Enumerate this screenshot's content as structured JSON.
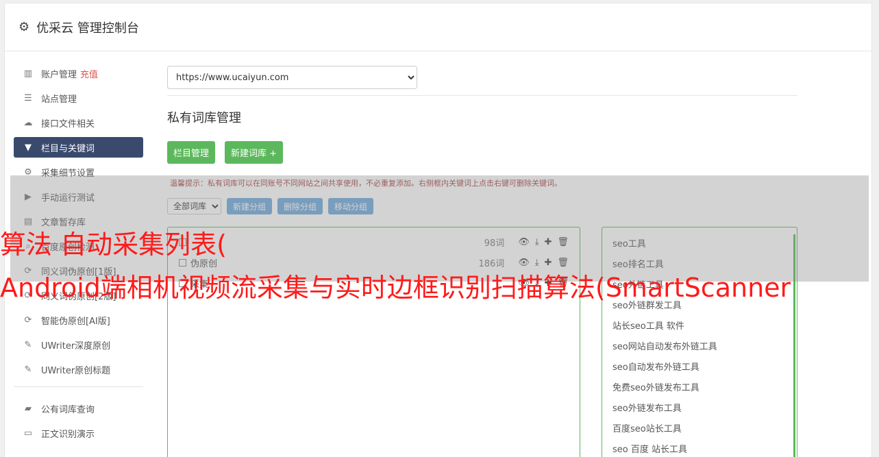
{
  "header": {
    "title": "优采云 管理控制台"
  },
  "sidebar": {
    "items": [
      {
        "label": "账户管理",
        "extra": "充值",
        "icon": "bar-chart-icon",
        "glyph": "▥"
      },
      {
        "label": "站点管理",
        "icon": "server-icon",
        "glyph": "☰"
      },
      {
        "label": "接口文件相关",
        "icon": "cloud-upload-icon",
        "glyph": "☁"
      },
      {
        "label": "栏目与关键词",
        "icon": "filter-icon",
        "glyph": "▼",
        "active": true
      },
      {
        "label": "采集细节设置",
        "icon": "gears-icon",
        "glyph": "⚙"
      },
      {
        "label": "手动运行测试",
        "icon": "play-circle-icon",
        "glyph": "▶"
      },
      {
        "label": "文章暂存库",
        "icon": "database-icon",
        "glyph": "▤"
      },
      {
        "label": "百度原创检测",
        "icon": "search-icon",
        "glyph": "⌕"
      },
      {
        "label": "同义词伪原创[1版]",
        "icon": "refresh-icon",
        "glyph": "⟳"
      },
      {
        "label": "同义词伪原创[2版]",
        "icon": "refresh-icon",
        "glyph": "⟳"
      },
      {
        "label": "智能伪原创[AI版]",
        "icon": "refresh-icon",
        "glyph": "⟳"
      },
      {
        "label": "UWriter深度原创",
        "icon": "edit-icon",
        "glyph": "✎"
      },
      {
        "label": "UWriter原创标题",
        "icon": "edit-icon",
        "glyph": "✎"
      }
    ],
    "items2": [
      {
        "label": "公有词库查询",
        "icon": "book-icon",
        "glyph": "▰"
      },
      {
        "label": "正文识别演示",
        "icon": "monitor-icon",
        "glyph": "▭"
      }
    ]
  },
  "main": {
    "site_select": "https://www.ucaiyun.com",
    "title": "私有词库管理",
    "btn_column": "栏目管理",
    "btn_new_lib": "新建词库 +",
    "tip": "温馨提示：私有词库可以在同账号不同网站之间共享使用，不必重复添加。右侧框内关键词上点击右键可删除关键词。",
    "group_select": "全部词库",
    "btn_new_group": "新建分组",
    "btn_del_group": "删除分组",
    "btn_move_group": "移动分组"
  },
  "libraries": [
    {
      "name": "",
      "count": "98词"
    },
    {
      "name": "伪原创",
      "count": "186词"
    },
    {
      "name": "采集",
      "count": ""
    }
  ],
  "keywords": [
    "seo工具",
    "seo排名工具",
    "seo外链工具",
    "seo外链群发工具",
    "站长seo工具 软件",
    "seo网站自动发布外链工具",
    "seo自动发布外链工具",
    "免费seo外链发布工具",
    "seo外链发布工具",
    "百度seo站长工具",
    "seo 百度 站长工具"
  ],
  "watermark": {
    "line1": "算法 自动采集列表(",
    "line2": "Android端相机视频流采集与实时边框识别扫描算法(SmartScanner"
  }
}
